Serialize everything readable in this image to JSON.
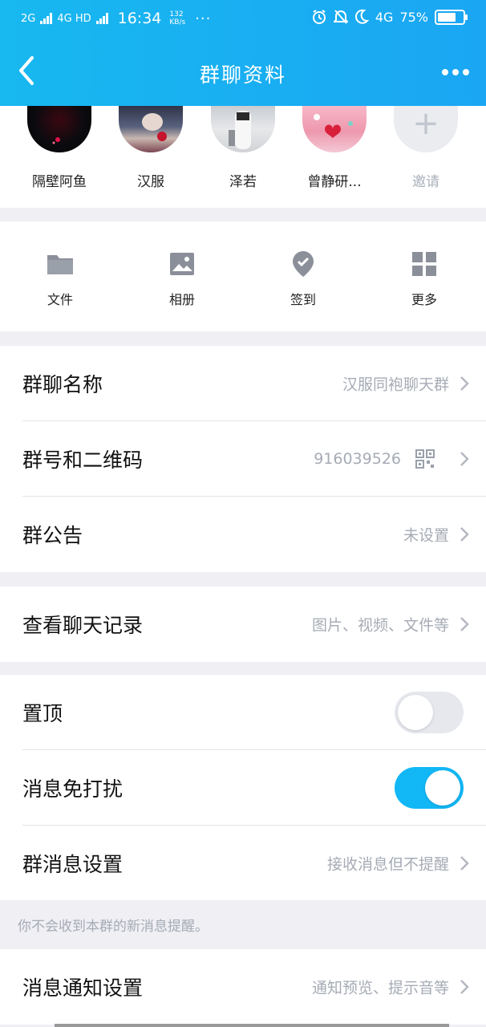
{
  "status_bar": {
    "network_1": "2G",
    "network_2": "4G HD",
    "time": "16:34",
    "speed_value": "132",
    "speed_unit": "KB/s",
    "more": "···",
    "network_3": "4G",
    "battery": "75%",
    "battery_level": 0.75
  },
  "nav": {
    "title": "群聊资料"
  },
  "members": [
    {
      "name": "隔壁阿鱼"
    },
    {
      "name": "汉服"
    },
    {
      "name": "泽若"
    },
    {
      "name": "曾静研..."
    },
    {
      "name": "邀请"
    }
  ],
  "tools": [
    {
      "label": "文件",
      "icon": "folder-icon"
    },
    {
      "label": "相册",
      "icon": "image-icon"
    },
    {
      "label": "签到",
      "icon": "checkin-icon"
    },
    {
      "label": "更多",
      "icon": "grid-icon"
    }
  ],
  "rows": {
    "group_name": {
      "label": "群聊名称",
      "value": "汉服同袍聊天群"
    },
    "group_number": {
      "label": "群号和二维码",
      "value": "916039526"
    },
    "announcement": {
      "label": "群公告",
      "value": "未设置"
    },
    "chat_history": {
      "label": "查看聊天记录",
      "value": "图片、视频、文件等"
    },
    "pin_top": {
      "label": "置顶",
      "enabled": false
    },
    "do_not_disturb": {
      "label": "消息免打扰",
      "enabled": true
    },
    "group_message_settings": {
      "label": "群消息设置",
      "value": "接收消息但不提醒"
    },
    "notification_settings": {
      "label": "消息通知设置",
      "value": "通知预览、提示音等"
    }
  },
  "hint": "你不会收到本群的新消息提醒。",
  "colors": {
    "header": "#1aa6f3",
    "toggle_on": "#12b7f5",
    "toggle_off": "#e6e8ee",
    "secondary_text": "#a6abb4"
  }
}
